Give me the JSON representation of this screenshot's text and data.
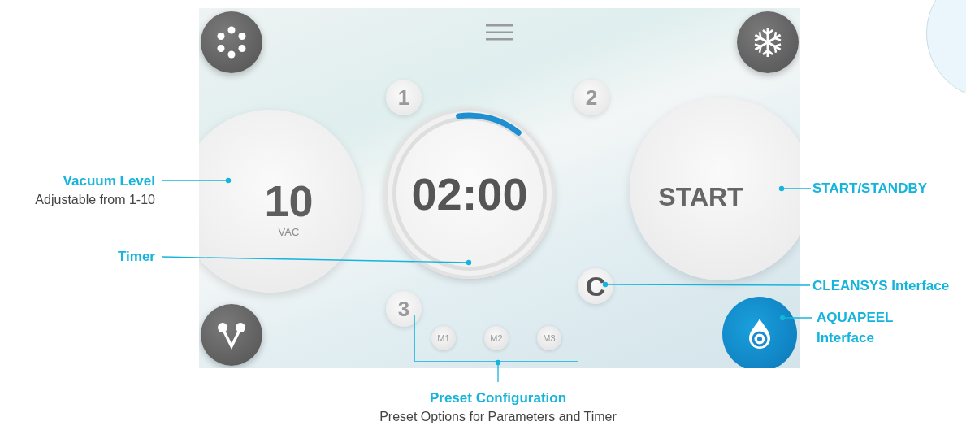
{
  "screen": {
    "vacuum": {
      "value": "10",
      "unit": "VAC"
    },
    "timer": {
      "time": "02:00",
      "level": 0.13
    },
    "presets": [
      {
        "label": "1"
      },
      {
        "label": "2"
      },
      {
        "label": "3"
      }
    ],
    "cleansys": {
      "label": "C"
    },
    "start": {
      "label": "START"
    },
    "memory_presets": [
      {
        "label": "M1"
      },
      {
        "label": "M2"
      },
      {
        "label": "M3"
      }
    ]
  },
  "callouts": [
    {
      "title": "Vacuum Level",
      "description": "Adjustable from 1-10"
    },
    {
      "title": "Timer"
    },
    {
      "title": "START/STANDBY"
    },
    {
      "title": "CLEANSYS Interface"
    },
    {
      "title": "AQUAPEEL Interface"
    },
    {
      "title": "Preset Configuration",
      "description": "Preset Options for Parameters and Timer"
    }
  ]
}
